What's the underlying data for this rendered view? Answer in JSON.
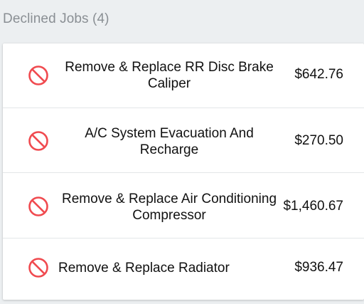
{
  "header": {
    "title": "Declined Jobs (4)"
  },
  "colors": {
    "decline_icon": "#f04a4f",
    "divider": "#e3e6e8",
    "background": "#eceff1"
  },
  "jobs": [
    {
      "title": "Remove & Replace RR Disc Brake Caliper",
      "price": "$642.76",
      "icon": "decline-icon"
    },
    {
      "title": "A/C System Evacuation And Recharge",
      "price": "$270.50",
      "icon": "decline-icon"
    },
    {
      "title": "Remove & Replace Air Conditioning Compressor",
      "price": "$1,460.67",
      "icon": "decline-icon"
    },
    {
      "title": "Remove & Replace Radiator",
      "price": "$936.47",
      "icon": "decline-icon"
    }
  ]
}
